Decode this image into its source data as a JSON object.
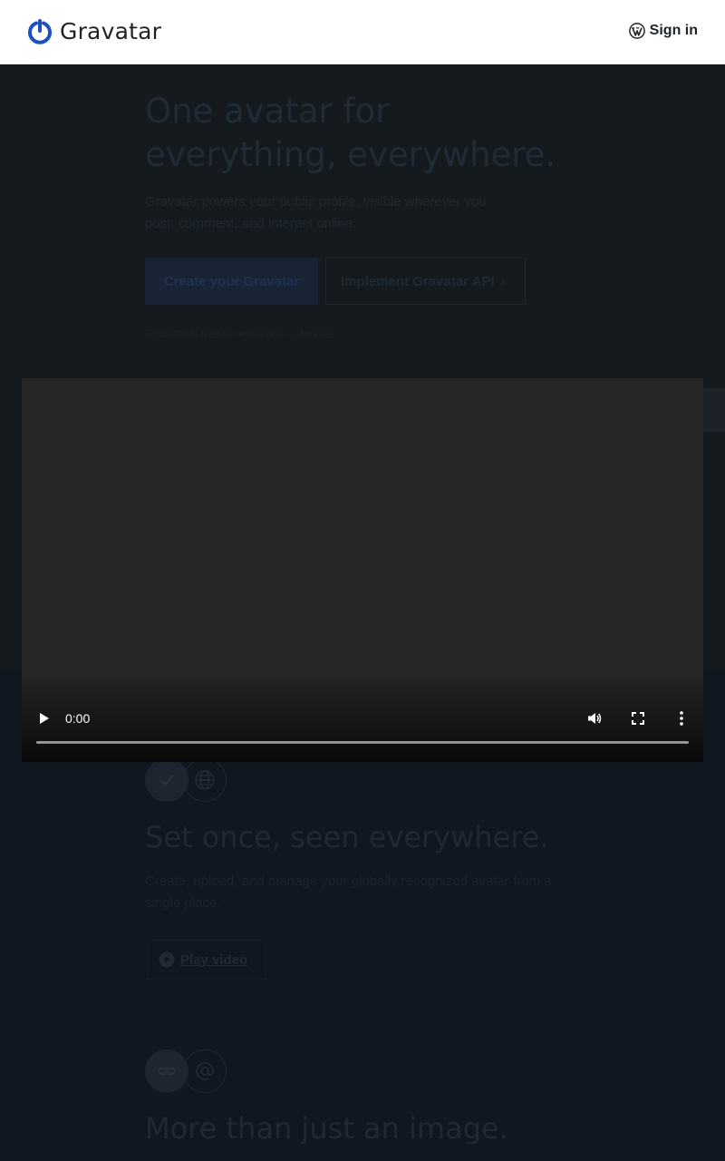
{
  "header": {
    "logo_text": "Gravatar",
    "sign_in_label": "Sign in"
  },
  "hero": {
    "title": "One avatar for everything, everywhere.",
    "subtitle": "Gravatar powers your public profile, visible wherever you post, comment, and interact online.",
    "primary_button": "Create your Gravatar",
    "secondary_button": "Implement Gravatar API",
    "secondary_arrow": "›",
    "note": "Gravatar is free for everyone — forever."
  },
  "video_player": {
    "current_time": "0:00",
    "controls": [
      "play-icon",
      "volume-icon",
      "fullscreen-icon",
      "more-options-icon"
    ],
    "progress": 0.0
  },
  "features": [
    {
      "icons": [
        "check-icon",
        "globe-icon"
      ],
      "title": "Set once, seen everywhere.",
      "text": "Create, upload, and manage your globally recognized avatar from a single place.",
      "button": "Play video"
    },
    {
      "icons": [
        "link-icon",
        "at-sign-icon"
      ],
      "title": "More than just an image."
    }
  ],
  "colors": {
    "brand_blue": "#1d4fc4",
    "header_bg": "#ffffff",
    "overlay_bg": "#101517",
    "video_bg": "#262626"
  }
}
